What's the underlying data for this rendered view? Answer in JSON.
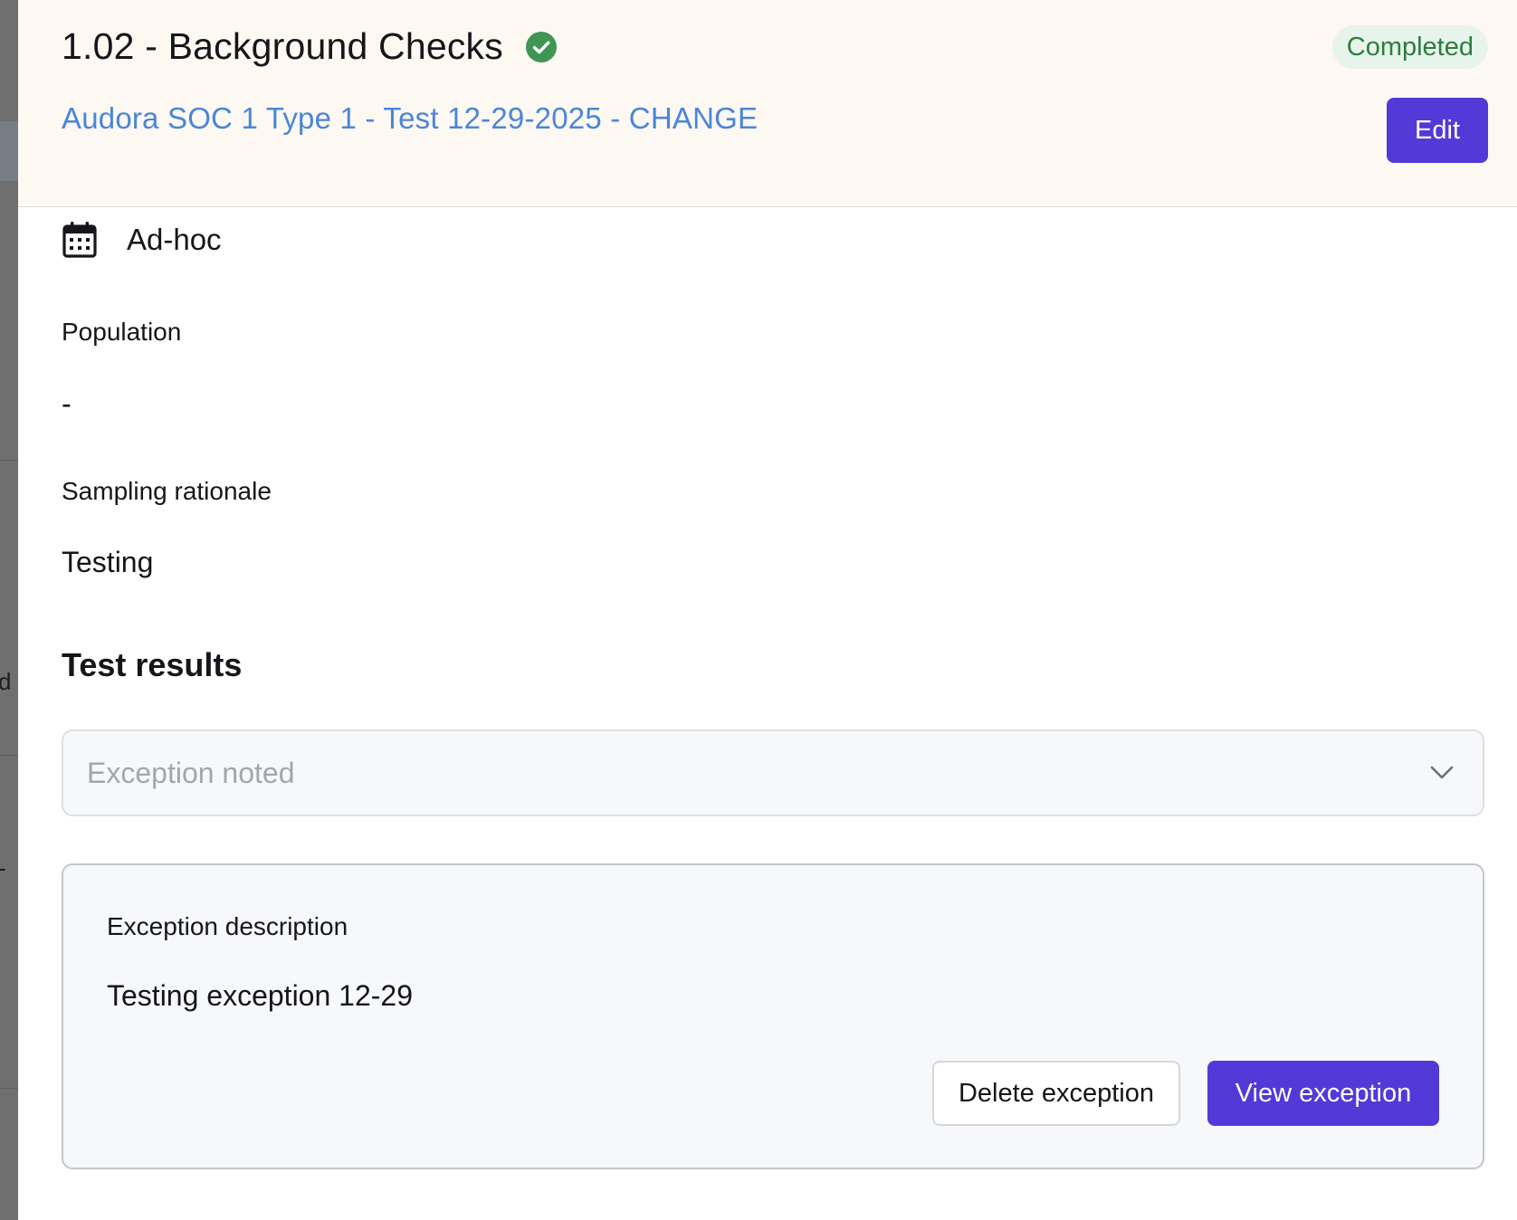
{
  "header": {
    "title": "1.02 - Background Checks",
    "status": "Completed",
    "project_link": "Audora SOC 1 Type 1 - Test 12-29-2025 - CHANGE",
    "edit_label": "Edit",
    "icons": {
      "status": "check-circle-icon"
    },
    "colors": {
      "header_bg": "#fdf8f2",
      "status_green": "#2e7d3f",
      "link_blue": "#4a86d9",
      "primary_purple": "#5339d8"
    }
  },
  "frequency": {
    "icon": "calendar-icon",
    "value": "Ad-hoc"
  },
  "population": {
    "label": "Population",
    "value": "-"
  },
  "sampling": {
    "label": "Sampling rationale",
    "value": "Testing"
  },
  "test_results": {
    "title": "Test results",
    "select_value": "Exception noted",
    "select_icon": "chevron-down-icon"
  },
  "exception": {
    "label": "Exception description",
    "value": "Testing exception 12-29",
    "delete_label": "Delete exception",
    "view_label": "View exception"
  },
  "background": {
    "edge_chars": [
      "d",
      "-"
    ]
  }
}
